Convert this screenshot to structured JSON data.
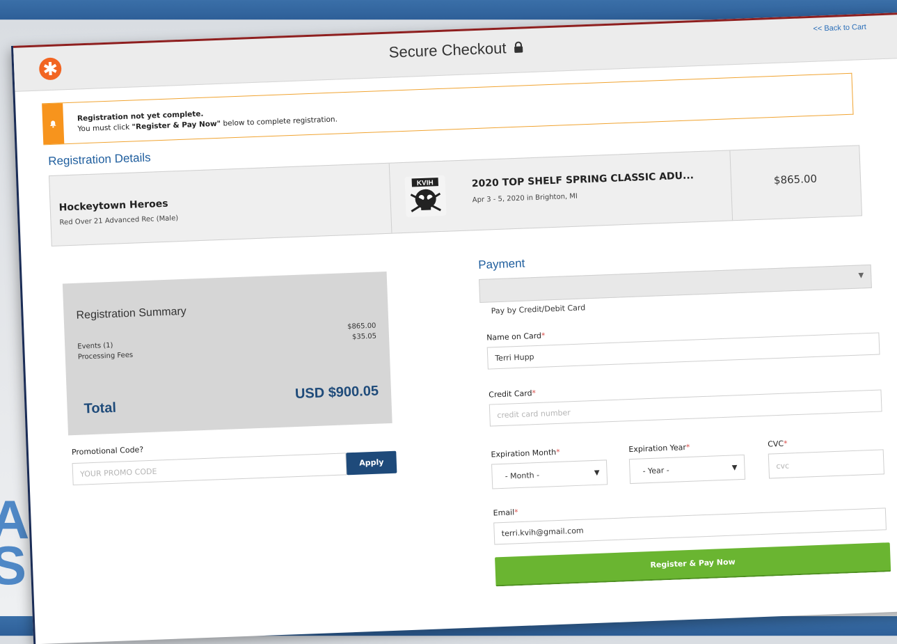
{
  "background": {
    "letters": "A\nS"
  },
  "header": {
    "title": "Secure Checkout",
    "back_link": "<< Back to Cart",
    "logo_glyph": "✱"
  },
  "alert": {
    "title": "Registration not yet complete.",
    "message_pre": "You must click ",
    "message_bold": "\"Register & Pay Now\"",
    "message_post": " below to complete registration."
  },
  "registration": {
    "section_title": "Registration Details",
    "team_name": "Hockeytown Heroes",
    "division": "Red Over 21 Advanced Rec (Male)",
    "event_logo_text": "KVIH",
    "event_name": "2020 TOP SHELF SPRING CLASSIC ADU...",
    "event_date": "Apr 3 - 5, 2020  in  Brighton, MI",
    "price": "$865.00"
  },
  "summary": {
    "title": "Registration Summary",
    "rows": [
      {
        "label": "Events (1)",
        "value": "$865.00"
      },
      {
        "label": "Processing Fees",
        "value": "$35.05"
      }
    ],
    "total_label": "Total",
    "total_value": "USD $900.05"
  },
  "promo": {
    "label": "Promotional Code?",
    "placeholder": "YOUR PROMO CODE",
    "apply_label": "Apply"
  },
  "payment": {
    "section_title": "Payment",
    "method": "Pay by Credit/Debit Card",
    "name_label": "Name on Card",
    "name_value": "Terri Hupp",
    "card_label": "Credit Card",
    "card_placeholder": "credit card number",
    "exp_month_label": "Expiration Month",
    "exp_month_value": "- Month -",
    "exp_year_label": "Expiration Year",
    "exp_year_value": "- Year -",
    "cvc_label": "CVC",
    "cvc_placeholder": "cvc",
    "email_label": "Email",
    "email_value": "terri.kvih@gmail.com",
    "required_marker": "*",
    "submit_label": "Register & Pay Now"
  },
  "colors": {
    "accent": "#1f5e9e",
    "submit": "#6ab531",
    "alert": "#f7941d",
    "logo": "#f26522"
  }
}
